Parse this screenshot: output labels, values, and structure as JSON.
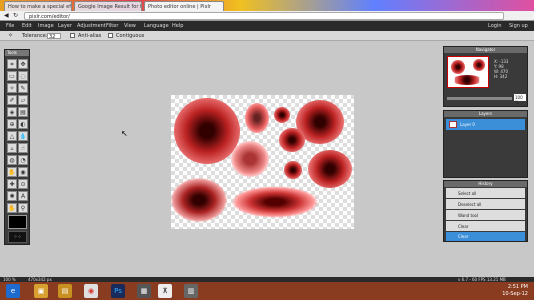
{
  "browser": {
    "tabs": [
      {
        "label": "How to make a special eff...",
        "active": false
      },
      {
        "label": "Google Image Result for ht...",
        "active": false
      },
      {
        "label": "Photo editor online | Pixlr",
        "active": true
      }
    ],
    "url": "pixlr.com/editor/"
  },
  "menu": [
    "File",
    "Edit",
    "Image",
    "Layer",
    "Adjustment",
    "Filter",
    "View",
    "Language",
    "Help"
  ],
  "account": {
    "login": "Login",
    "signup": "Sign up"
  },
  "options": {
    "tolerance_label": "Tolerance:",
    "tolerance_value": "32",
    "antialias": "Anti-alias",
    "contiguous": "Contiguous"
  },
  "tools_title": "Tools",
  "navigator": {
    "title": "Navigator",
    "x_label": "X:",
    "x_value": "-133",
    "y_label": "Y:",
    "y_value": "98",
    "w_label": "W:",
    "w_value": "470",
    "h_label": "H:",
    "h_value": "342",
    "zoom": "100 %"
  },
  "layers": {
    "title": "Layers",
    "items": [
      {
        "label": "Layer 0"
      }
    ]
  },
  "history": {
    "title": "History",
    "items": [
      {
        "label": "Select all",
        "selected": false
      },
      {
        "label": "Deselect all",
        "selected": false
      },
      {
        "label": "Wand tool",
        "selected": false
      },
      {
        "label": "Clear",
        "selected": false
      },
      {
        "label": "Clear",
        "selected": true
      }
    ]
  },
  "status": {
    "zoom": "100 %",
    "size": "470x342 px",
    "perf": "v 6.7 - 60 FPS 13.21 MB"
  },
  "clock": {
    "time": "2:51 PM",
    "date": "10-Sep-12"
  },
  "colors": {
    "accent": "#3a8fd8",
    "panel": "#3a3a3a",
    "taskbar": "#8a3c20"
  }
}
